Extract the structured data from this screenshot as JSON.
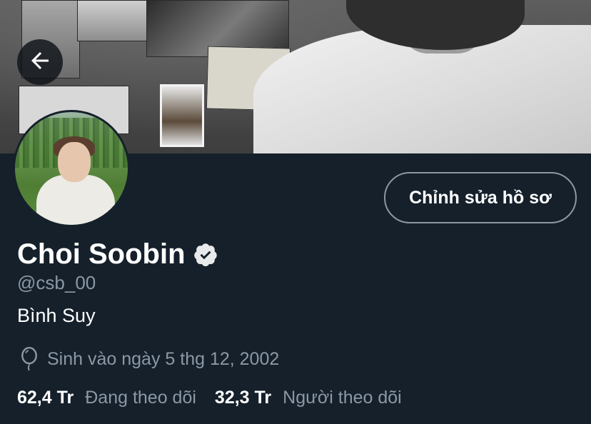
{
  "header": {
    "back_icon": "arrow-left-icon"
  },
  "profile": {
    "display_name": "Choi Soobin",
    "verified_icon": "verified-badge-icon",
    "handle": "@csb_00",
    "bio": "Bình Suy",
    "birth_icon": "balloon-icon",
    "birth_text": "Sinh vào ngày 5 thg 12, 2002",
    "edit_button_label": "Chỉnh sửa hồ sơ"
  },
  "stats": {
    "following_count": "62,4 Tr",
    "following_label": "Đang theo dõi",
    "followers_count": "32,3 Tr",
    "followers_label": "Người theo dõi"
  },
  "colors": {
    "background": "#15202b",
    "secondary_text": "#8b98a5",
    "primary_text": "#ffffff"
  }
}
